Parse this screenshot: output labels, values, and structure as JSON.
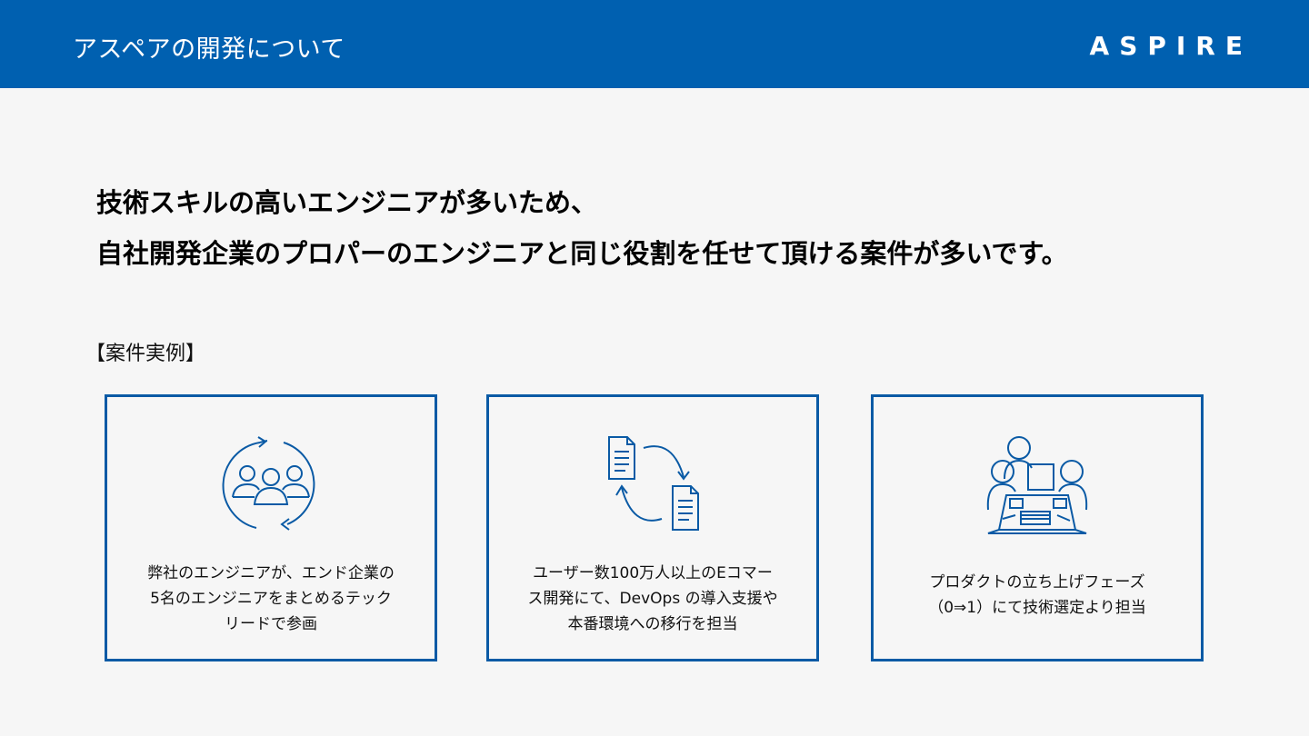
{
  "header": {
    "title": "アスペアの開発について",
    "logo_text": "ASPIRE",
    "background_color": "#0060b0"
  },
  "headline": {
    "line1": "技術スキルの高いエンジニアが多いため、",
    "line2": "自社開発企業のプロパーのエンジニアと同じ役割を任せて頂ける案件が多いです。"
  },
  "section_label": "【案件実例】",
  "cards": [
    {
      "icon": "team-cycle-icon",
      "lines": [
        "弊社のエンジニアが、エンド企業の",
        "5名のエンジニアをまとめるテック",
        "リードで参画"
      ]
    },
    {
      "icon": "document-sync-icon",
      "lines": [
        "ユーザー数100万人以上のEコマー",
        "ス開発にて、DevOps の導入支援や",
        "本番環境への移行を担当"
      ]
    },
    {
      "icon": "meeting-table-icon",
      "lines": [
        "プロダクトの立ち上げフェーズ",
        "（0⇒1）にて技術選定より担当"
      ]
    }
  ],
  "accent_color": "#0a5aa5"
}
